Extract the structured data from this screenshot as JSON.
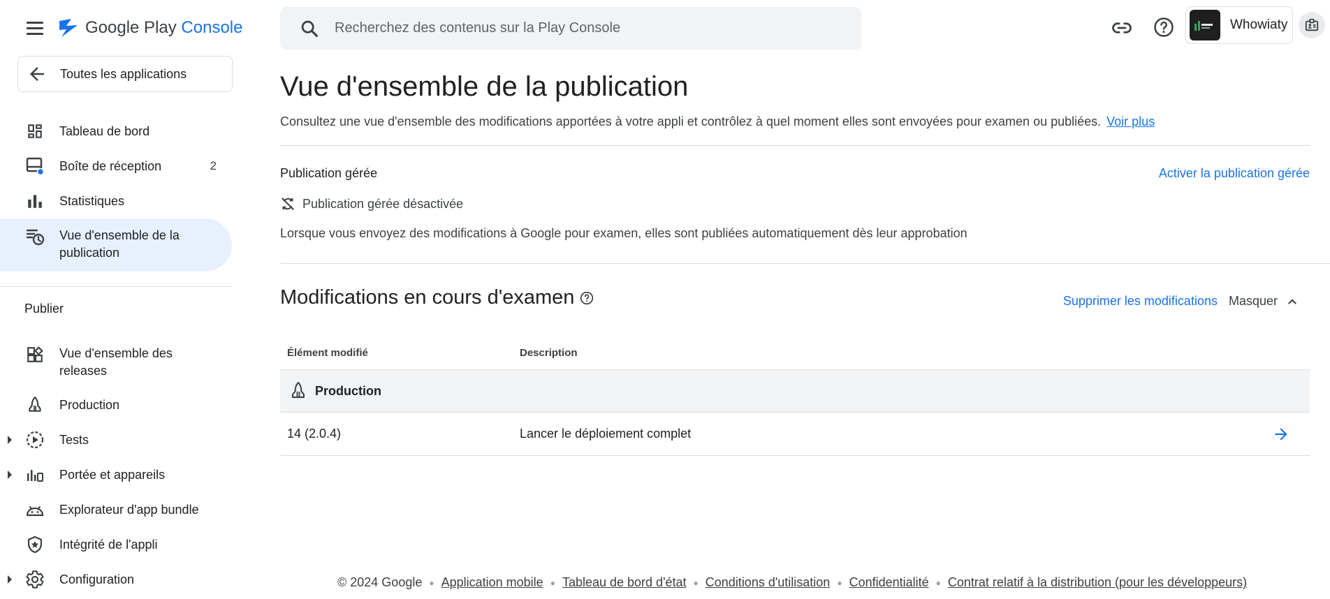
{
  "brand": {
    "name_part1": "Google Play",
    "name_part2": "Console"
  },
  "sidebar": {
    "all_apps": "Toutes les applications",
    "items": [
      {
        "label": "Tableau de bord",
        "icon": "dashboard-icon"
      },
      {
        "label": "Boîte de réception",
        "icon": "inbox-icon",
        "badge": "2"
      },
      {
        "label": "Statistiques",
        "icon": "bar-chart-icon"
      },
      {
        "label": "Vue d'ensemble de la publication",
        "icon": "publishing-overview-icon",
        "active": true
      }
    ],
    "section": "Publier",
    "publish_items": [
      {
        "label": "Vue d'ensemble des releases",
        "icon": "releases-overview-icon"
      },
      {
        "label": "Production",
        "icon": "production-icon"
      },
      {
        "label": "Tests",
        "icon": "testing-icon",
        "expandable": true
      },
      {
        "label": "Portée et appareils",
        "icon": "reach-devices-icon",
        "expandable": true
      },
      {
        "label": "Explorateur d'app bundle",
        "icon": "android-icon"
      },
      {
        "label": "Intégrité de l'appli",
        "icon": "shield-icon"
      },
      {
        "label": "Configuration",
        "icon": "gear-icon",
        "expandable": true
      }
    ]
  },
  "search": {
    "placeholder": "Recherchez des contenus sur la Play Console"
  },
  "account": {
    "name": "Whowiaty"
  },
  "main": {
    "title": "Vue d'ensemble de la publication",
    "subtitle": "Consultez une vue d'ensemble des modifications apportées à votre appli et contrôlez à quel moment elles sont envoyées pour examen ou publiées.",
    "see_more": "Voir plus",
    "managed": {
      "title": "Publication gérée",
      "activate": "Activer la publication gérée",
      "status": "Publication gérée désactivée",
      "description": "Lorsque vous envoyez des modifications à Google pour examen, elles sont publiées automatiquement dès leur approbation"
    },
    "review": {
      "title": "Modifications en cours d'examen",
      "delete": "Supprimer les modifications",
      "hide": "Masquer",
      "columns": [
        "Élément modifié",
        "Description"
      ],
      "group": "Production",
      "rows": [
        {
          "item": "14 (2.0.4)",
          "description": "Lancer le déploiement complet"
        }
      ]
    }
  },
  "footer": {
    "copyright": "© 2024 Google",
    "links": [
      "Application mobile",
      "Tableau de bord d'état",
      "Conditions d'utilisation",
      "Confidentialité",
      "Contrat relatif à la distribution (pour les développeurs)"
    ]
  },
  "colors": {
    "accent": "#1a73e8",
    "active_bg": "#e8f0fe",
    "inbox_dot": "#1a73e8"
  }
}
